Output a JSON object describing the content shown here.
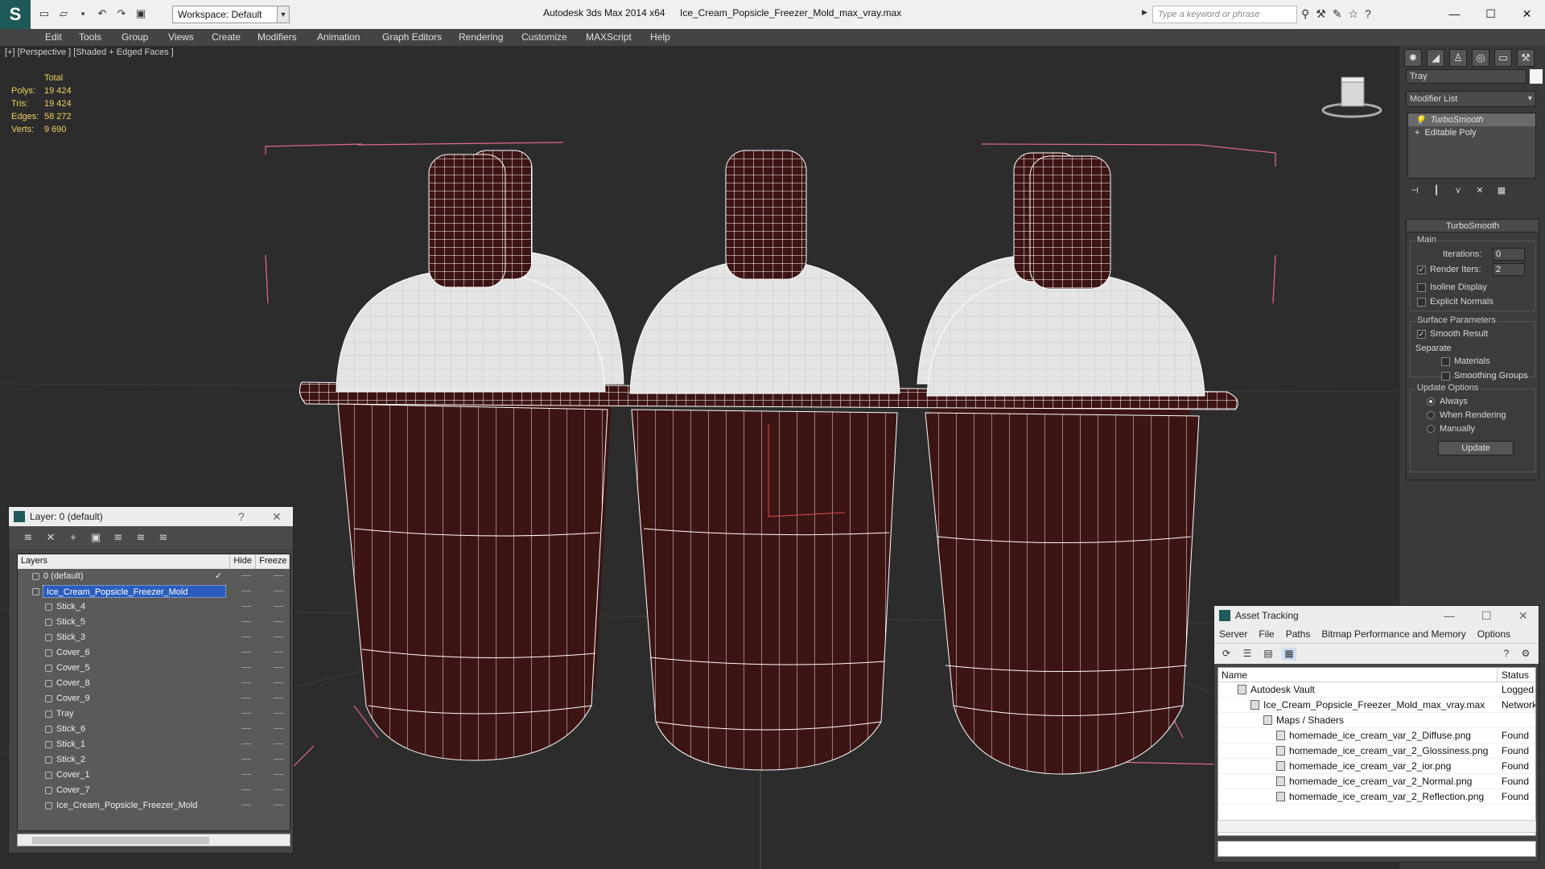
{
  "app": {
    "title": "Autodesk 3ds Max  2014 x64",
    "file": "Ice_Cream_Popsicle_Freezer_Mold_max_vray.max",
    "workspace": "Workspace: Default",
    "search_placeholder": "Type a keyword or phrase"
  },
  "menu": [
    "Edit",
    "Tools",
    "Group",
    "Views",
    "Create",
    "Modifiers",
    "Animation",
    "Graph Editors",
    "Rendering",
    "Customize",
    "MAXScript",
    "Help"
  ],
  "viewport": {
    "label": "[+] [Perspective ] [Shaded + Edged Faces ]",
    "stats_header": "Total",
    "stats": [
      {
        "k": "Polys:",
        "v": "19 424"
      },
      {
        "k": "Tris:",
        "v": "19 424"
      },
      {
        "k": "Edges:",
        "v": "58 272"
      },
      {
        "k": "Verts:",
        "v": "9 690"
      }
    ]
  },
  "command_panel": {
    "object_name": "Tray",
    "modifier_list": "Modifier List",
    "stack": [
      "TurboSmooth",
      "Editable Poly"
    ],
    "turbosmooth": {
      "header": "TurboSmooth",
      "main": "Main",
      "iterations_label": "Iterations:",
      "iterations": "0",
      "render_iters_label": "Render Iters:",
      "render_iters": "2",
      "isoline": "Isoline Display",
      "explicit": "Explicit Normals",
      "surface": "Surface Parameters",
      "smooth_result": "Smooth Result",
      "separate": "Separate",
      "materials": "Materials",
      "smoothing_groups": "Smoothing Groups",
      "update_options": "Update Options",
      "always": "Always",
      "when_rendering": "When Rendering",
      "manually": "Manually",
      "update": "Update"
    }
  },
  "layers": {
    "title": "Layer: 0 (default)",
    "col_layers": "Layers",
    "col_hide": "Hide",
    "col_freeze": "Freeze",
    "rows": [
      {
        "name": "0 (default)",
        "indent": 0,
        "type": "layer"
      },
      {
        "name": "Ice_Cream_Popsicle_Freezer_Mold",
        "indent": 0,
        "type": "layer",
        "selected": true
      },
      {
        "name": "Stick_4",
        "indent": 1,
        "type": "obj"
      },
      {
        "name": "Stick_5",
        "indent": 1,
        "type": "obj"
      },
      {
        "name": "Stick_3",
        "indent": 1,
        "type": "obj"
      },
      {
        "name": "Cover_6",
        "indent": 1,
        "type": "obj"
      },
      {
        "name": "Cover_5",
        "indent": 1,
        "type": "obj"
      },
      {
        "name": "Cover_8",
        "indent": 1,
        "type": "obj"
      },
      {
        "name": "Cover_9",
        "indent": 1,
        "type": "obj"
      },
      {
        "name": "Tray",
        "indent": 1,
        "type": "obj"
      },
      {
        "name": "Stick_6",
        "indent": 1,
        "type": "obj"
      },
      {
        "name": "Stick_1",
        "indent": 1,
        "type": "obj"
      },
      {
        "name": "Stick_2",
        "indent": 1,
        "type": "obj"
      },
      {
        "name": "Cover_1",
        "indent": 1,
        "type": "obj"
      },
      {
        "name": "Cover_7",
        "indent": 1,
        "type": "obj"
      },
      {
        "name": "Ice_Cream_Popsicle_Freezer_Mold",
        "indent": 1,
        "type": "obj"
      }
    ]
  },
  "asset": {
    "title": "Asset Tracking",
    "menu": [
      "Server",
      "File",
      "Paths",
      "Bitmap Performance and Memory",
      "Options"
    ],
    "col_name": "Name",
    "col_status": "Status",
    "rows": [
      {
        "name": "Autodesk Vault",
        "status": "Logged",
        "indent": 0
      },
      {
        "name": "Ice_Cream_Popsicle_Freezer_Mold_max_vray.max",
        "status": "Network",
        "indent": 1
      },
      {
        "name": "Maps / Shaders",
        "status": "",
        "indent": 2
      },
      {
        "name": "homemade_ice_cream_var_2_Diffuse.png",
        "status": "Found",
        "indent": 3
      },
      {
        "name": "homemade_ice_cream_var_2_Glossiness.png",
        "status": "Found",
        "indent": 3
      },
      {
        "name": "homemade_ice_cream_var_2_ior.png",
        "status": "Found",
        "indent": 3
      },
      {
        "name": "homemade_ice_cream_var_2_Normal.png",
        "status": "Found",
        "indent": 3
      },
      {
        "name": "homemade_ice_cream_var_2_Reflection.png",
        "status": "Found",
        "indent": 3
      }
    ]
  },
  "colors": {
    "cup": "#3d1414",
    "cover": "#e4e4e4",
    "wire": "#ffffff",
    "bbox": "#e0689a",
    "stats": "#f0d060",
    "selection": "#2a5dbe"
  }
}
